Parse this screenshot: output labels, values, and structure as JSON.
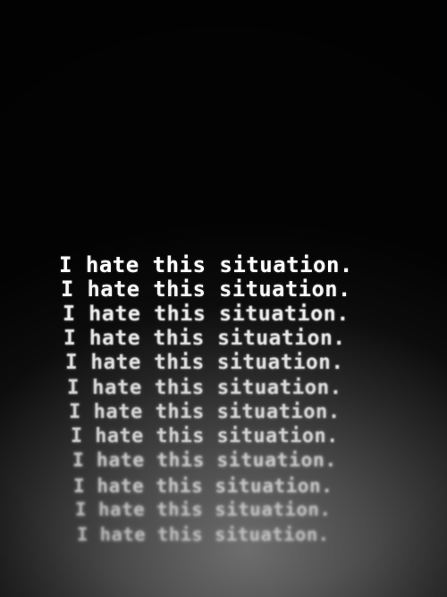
{
  "lines": [
    "I hate this situation.",
    "I hate this situation.",
    "I hate this situation.",
    "I hate this situation.",
    "I hate this situation.",
    "I hate this situation.",
    "I hate this situation.",
    "I hate this situation.",
    "I hate this situation.",
    "I hate this situation.",
    "I hate this situation.",
    "I hate this situation."
  ],
  "colors": {
    "text_top": "#ffffff",
    "text_bottom": "#d8d8d8",
    "background": "#000000"
  }
}
